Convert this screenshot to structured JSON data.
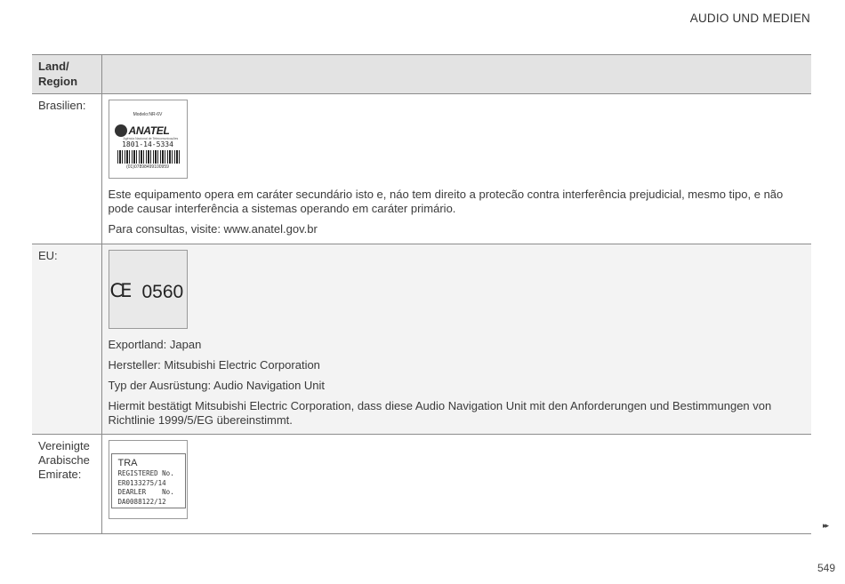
{
  "header": {
    "section_title": "AUDIO UND MEDIEN"
  },
  "table": {
    "column_header_1": "Land/ Region",
    "column_header_2": "",
    "rows": [
      {
        "land": "Brasilien:",
        "label": {
          "model": "Modelo:NR-6V",
          "brand": "ANATEL",
          "agency": "Agência Nacional de Telecomunicações",
          "number": "1801-14-5334",
          "barcode_text": "(01)07898499100959"
        },
        "texts": [
          "Este equipamento opera em caráter secundário isto e, náo tem direito a protecão contra interferência prejudicial, mesmo tipo, e não pode causar interferência a sistemas operando em caráter primário.",
          "Para consultas, visite: www.anatel.gov.br"
        ]
      },
      {
        "land": "EU:",
        "label": {
          "mark": "CE",
          "number": "0560"
        },
        "texts": [
          "Exportland: Japan",
          "Hersteller: Mitsubishi Electric Corporation",
          "Typ der Ausrüstung: Audio Navigation Unit",
          "Hiermit bestätigt Mitsubishi Electric Corporation, dass diese Audio Navigation Unit mit den Anforderungen und Bestimmungen von Richtlinie 1999/5/EG übereinstimmt."
        ]
      },
      {
        "land": "Vereinigte Arabische Emirate:",
        "label": {
          "title": "TRA",
          "line1": "REGISTERED No.",
          "line2": "ER0133275/14",
          "line3": "DEARLER    No.",
          "line4": "DA0088122/12"
        }
      }
    ]
  },
  "footer": {
    "next_icon_glyph": "▸▸",
    "page_number": "549"
  }
}
